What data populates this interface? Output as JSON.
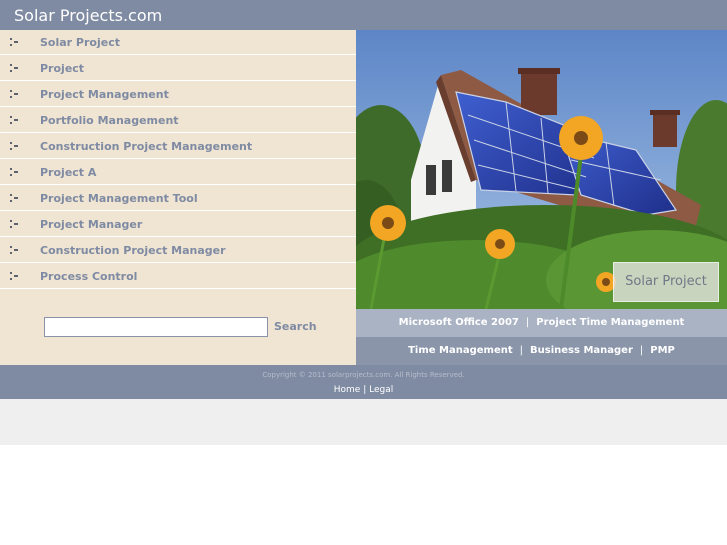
{
  "header": {
    "title": "Solar Projects.com"
  },
  "sidebar": {
    "items": [
      {
        "label": "Solar Project"
      },
      {
        "label": "Project"
      },
      {
        "label": "Project Management"
      },
      {
        "label": "Portfolio Management"
      },
      {
        "label": "Construction Project Management"
      },
      {
        "label": "Project A"
      },
      {
        "label": "Project Management Tool"
      },
      {
        "label": "Project Manager"
      },
      {
        "label": "Construction Project Manager"
      },
      {
        "label": "Process Control"
      }
    ],
    "bullet_icon": "square-dots-bullet-icon"
  },
  "search": {
    "value": "",
    "placeholder": "",
    "button_label": "Search"
  },
  "hero": {
    "caption": "Solar Project"
  },
  "links_row1": [
    "Microsoft Office 2007",
    "Project Time Management"
  ],
  "links_row2": [
    "Time Management",
    "Business Manager",
    "PMP"
  ],
  "footer": {
    "copyright": "Copyright © 2011 solarprojects.com. All Rights Reserved.",
    "links": [
      "Home",
      "Legal"
    ],
    "separator": "|"
  },
  "colors": {
    "header_bg": "#7f8ba3",
    "sidebar_bg": "#efe5d2",
    "nav_text": "#7f8aa3",
    "link_row1_bg": "#aab3c4",
    "link_row2_bg": "#8a95aa"
  }
}
